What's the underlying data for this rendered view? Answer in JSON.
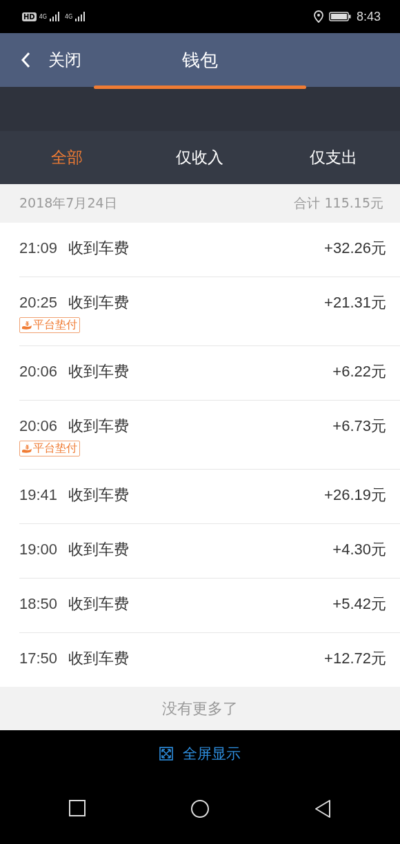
{
  "status_bar": {
    "badges": [
      "HD"
    ],
    "networks": [
      "4G",
      "4G"
    ],
    "time": "8:43"
  },
  "header": {
    "back_label": "关闭",
    "title": "钱包"
  },
  "filter_tabs": [
    {
      "label": "全部",
      "selected": true
    },
    {
      "label": "仅收入",
      "selected": false
    },
    {
      "label": "仅支出",
      "selected": false
    }
  ],
  "date_group": {
    "date": "2018年7月24日",
    "total": "合计 115.15元"
  },
  "transactions": [
    {
      "time": "21:09",
      "title": "收到车费",
      "amount": "+32.26元"
    },
    {
      "time": "20:25",
      "title": "收到车费",
      "amount": "+21.31元",
      "tag": "平台垫付"
    },
    {
      "time": "20:06",
      "title": "收到车费",
      "amount": "+6.22元"
    },
    {
      "time": "20:06",
      "title": "收到车费",
      "amount": "+6.73元",
      "tag": "平台垫付"
    },
    {
      "time": "19:41",
      "title": "收到车费",
      "amount": "+26.19元"
    },
    {
      "time": "19:00",
      "title": "收到车费",
      "amount": "+4.30元"
    },
    {
      "time": "18:50",
      "title": "收到车费",
      "amount": "+5.42元"
    },
    {
      "time": "17:50",
      "title": "收到车费",
      "amount": "+12.72元"
    }
  ],
  "end_note": "没有更多了",
  "fullscreen_button": "全屏显示"
}
